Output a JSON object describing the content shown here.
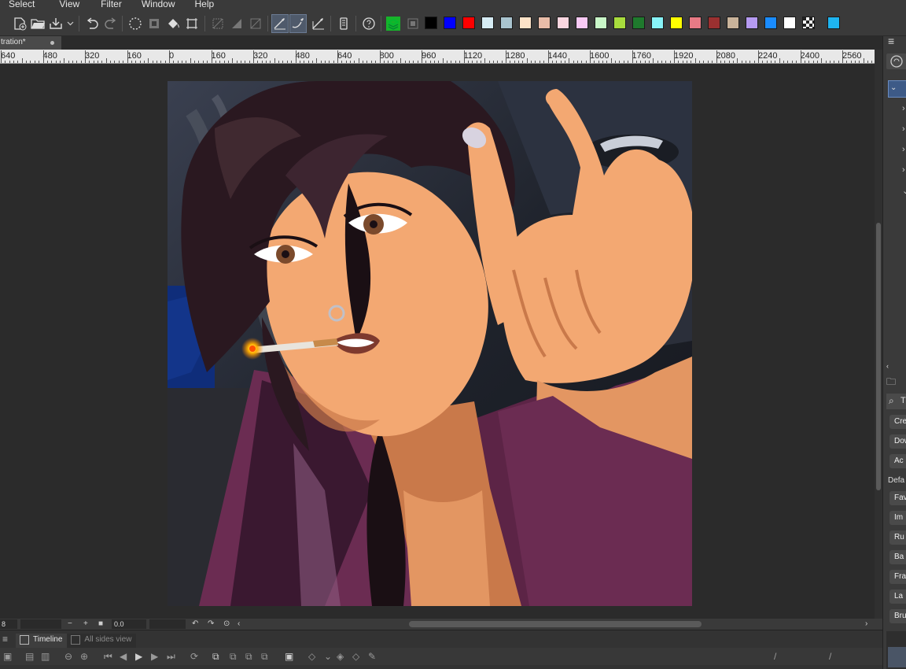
{
  "menu": {
    "items": [
      "Select",
      "View",
      "Filter",
      "Window",
      "Help"
    ]
  },
  "toolbar": {
    "swatches": [
      "#000000",
      "#0000ff",
      "#ff0000",
      "#d6ecf4",
      "#a9c4cf",
      "#fde3c8",
      "#e8bca8",
      "#fbd6e0",
      "#f9c9f4",
      "#c9f7c8",
      "#a8dc3d",
      "#1f7a2d",
      "#87f3f7",
      "#ffff00",
      "#e87a85",
      "#9b3030",
      "#c9b39a",
      "#b69bf2",
      "#1a8cff",
      "#ffffff",
      "checker",
      "#1eb4f0"
    ]
  },
  "document": {
    "tab_label": "tration*"
  },
  "ruler": {
    "labels": [
      "640",
      "480",
      "320",
      "160",
      "0",
      "160",
      "320",
      "480",
      "640",
      "800",
      "960",
      "1120",
      "1280",
      "1440",
      "1600",
      "1760",
      "1920",
      "2080",
      "2240",
      "2400",
      "2560"
    ]
  },
  "status": {
    "zoom": "8",
    "angle": "0.0"
  },
  "timeline": {
    "tab_active": "Timeline",
    "tab_inactive": "All sides view"
  },
  "rightdock": {
    "buttons": [
      "Cre",
      "Dow",
      "Ac",
      "Fav",
      "Im",
      "Ru",
      "Ba",
      "Fra",
      "La",
      "Bru"
    ],
    "default_label": "Defa",
    "search_label": "T"
  },
  "colors": {
    "skin": "#f3a872",
    "skin_shadow": "#c9794a",
    "hair": "#2a1820",
    "jacket": "#6b2c52",
    "jacket_dark": "#3a1830",
    "bg_car": "#1f232c"
  }
}
